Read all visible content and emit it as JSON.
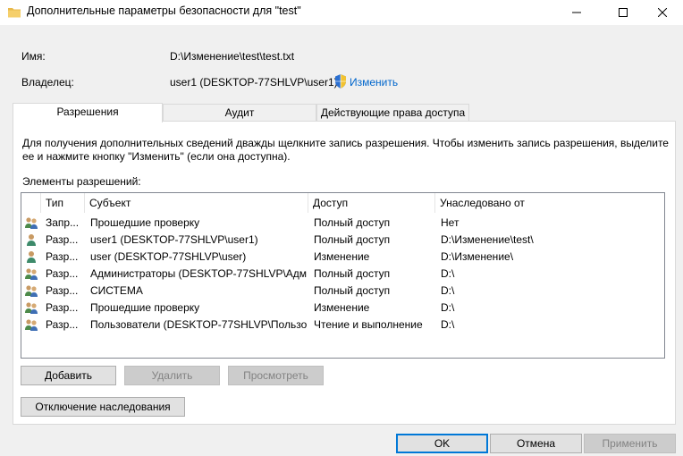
{
  "window": {
    "title": "Дополнительные параметры безопасности  для \"test\""
  },
  "info": {
    "name_label": "Имя:",
    "name_value": "D:\\Изменение\\test\\test.txt",
    "owner_label": "Владелец:",
    "owner_value": "user1 (DESKTOP-77SHLVP\\user1)",
    "change_link": "Изменить"
  },
  "tabs": [
    {
      "label": "Разрешения",
      "active": true
    },
    {
      "label": "Аудит",
      "active": false
    },
    {
      "label": "Действующие права доступа",
      "active": false
    }
  ],
  "description": {
    "line1": "Для получения дополнительных сведений дважды щелкните запись разрешения. Чтобы изменить запись разрешения, выделите",
    "line2": "ее и нажмите кнопку \"Изменить\" (если она доступна)."
  },
  "list": {
    "label": "Элементы разрешений:",
    "columns": [
      "Тип",
      "Субъект",
      "Доступ",
      "Унаследовано от"
    ],
    "rows": [
      {
        "icon": "group-icon",
        "type": "Запр...",
        "subject": "Прошедшие проверку",
        "access": "Полный доступ",
        "inherited": "Нет"
      },
      {
        "icon": "user-icon",
        "type": "Разр...",
        "subject": "user1 (DESKTOP-77SHLVP\\user1)",
        "access": "Полный доступ",
        "inherited": "D:\\Изменение\\test\\"
      },
      {
        "icon": "user-icon",
        "type": "Разр...",
        "subject": "user (DESKTOP-77SHLVP\\user)",
        "access": "Изменение",
        "inherited": "D:\\Изменение\\"
      },
      {
        "icon": "group-icon",
        "type": "Разр...",
        "subject": "Администраторы (DESKTOP-77SHLVP\\Адм...",
        "access": "Полный доступ",
        "inherited": "D:\\"
      },
      {
        "icon": "group-icon",
        "type": "Разр...",
        "subject": "СИСТЕМА",
        "access": "Полный доступ",
        "inherited": "D:\\"
      },
      {
        "icon": "group-icon",
        "type": "Разр...",
        "subject": "Прошедшие проверку",
        "access": "Изменение",
        "inherited": "D:\\"
      },
      {
        "icon": "group-icon",
        "type": "Разр...",
        "subject": "Пользователи (DESKTOP-77SHLVP\\Пользо...",
        "access": "Чтение и выполнение",
        "inherited": "D:\\"
      }
    ]
  },
  "actions": {
    "add": "Добавить",
    "remove": "Удалить",
    "view": "Просмотреть",
    "disable_inheritance": "Отключение наследования"
  },
  "footer": {
    "ok": "OK",
    "cancel": "Отмена",
    "apply": "Применить"
  },
  "colors": {
    "accent": "#0078d7",
    "link": "#0066cc",
    "dialog_bg": "#f0f0f0"
  }
}
